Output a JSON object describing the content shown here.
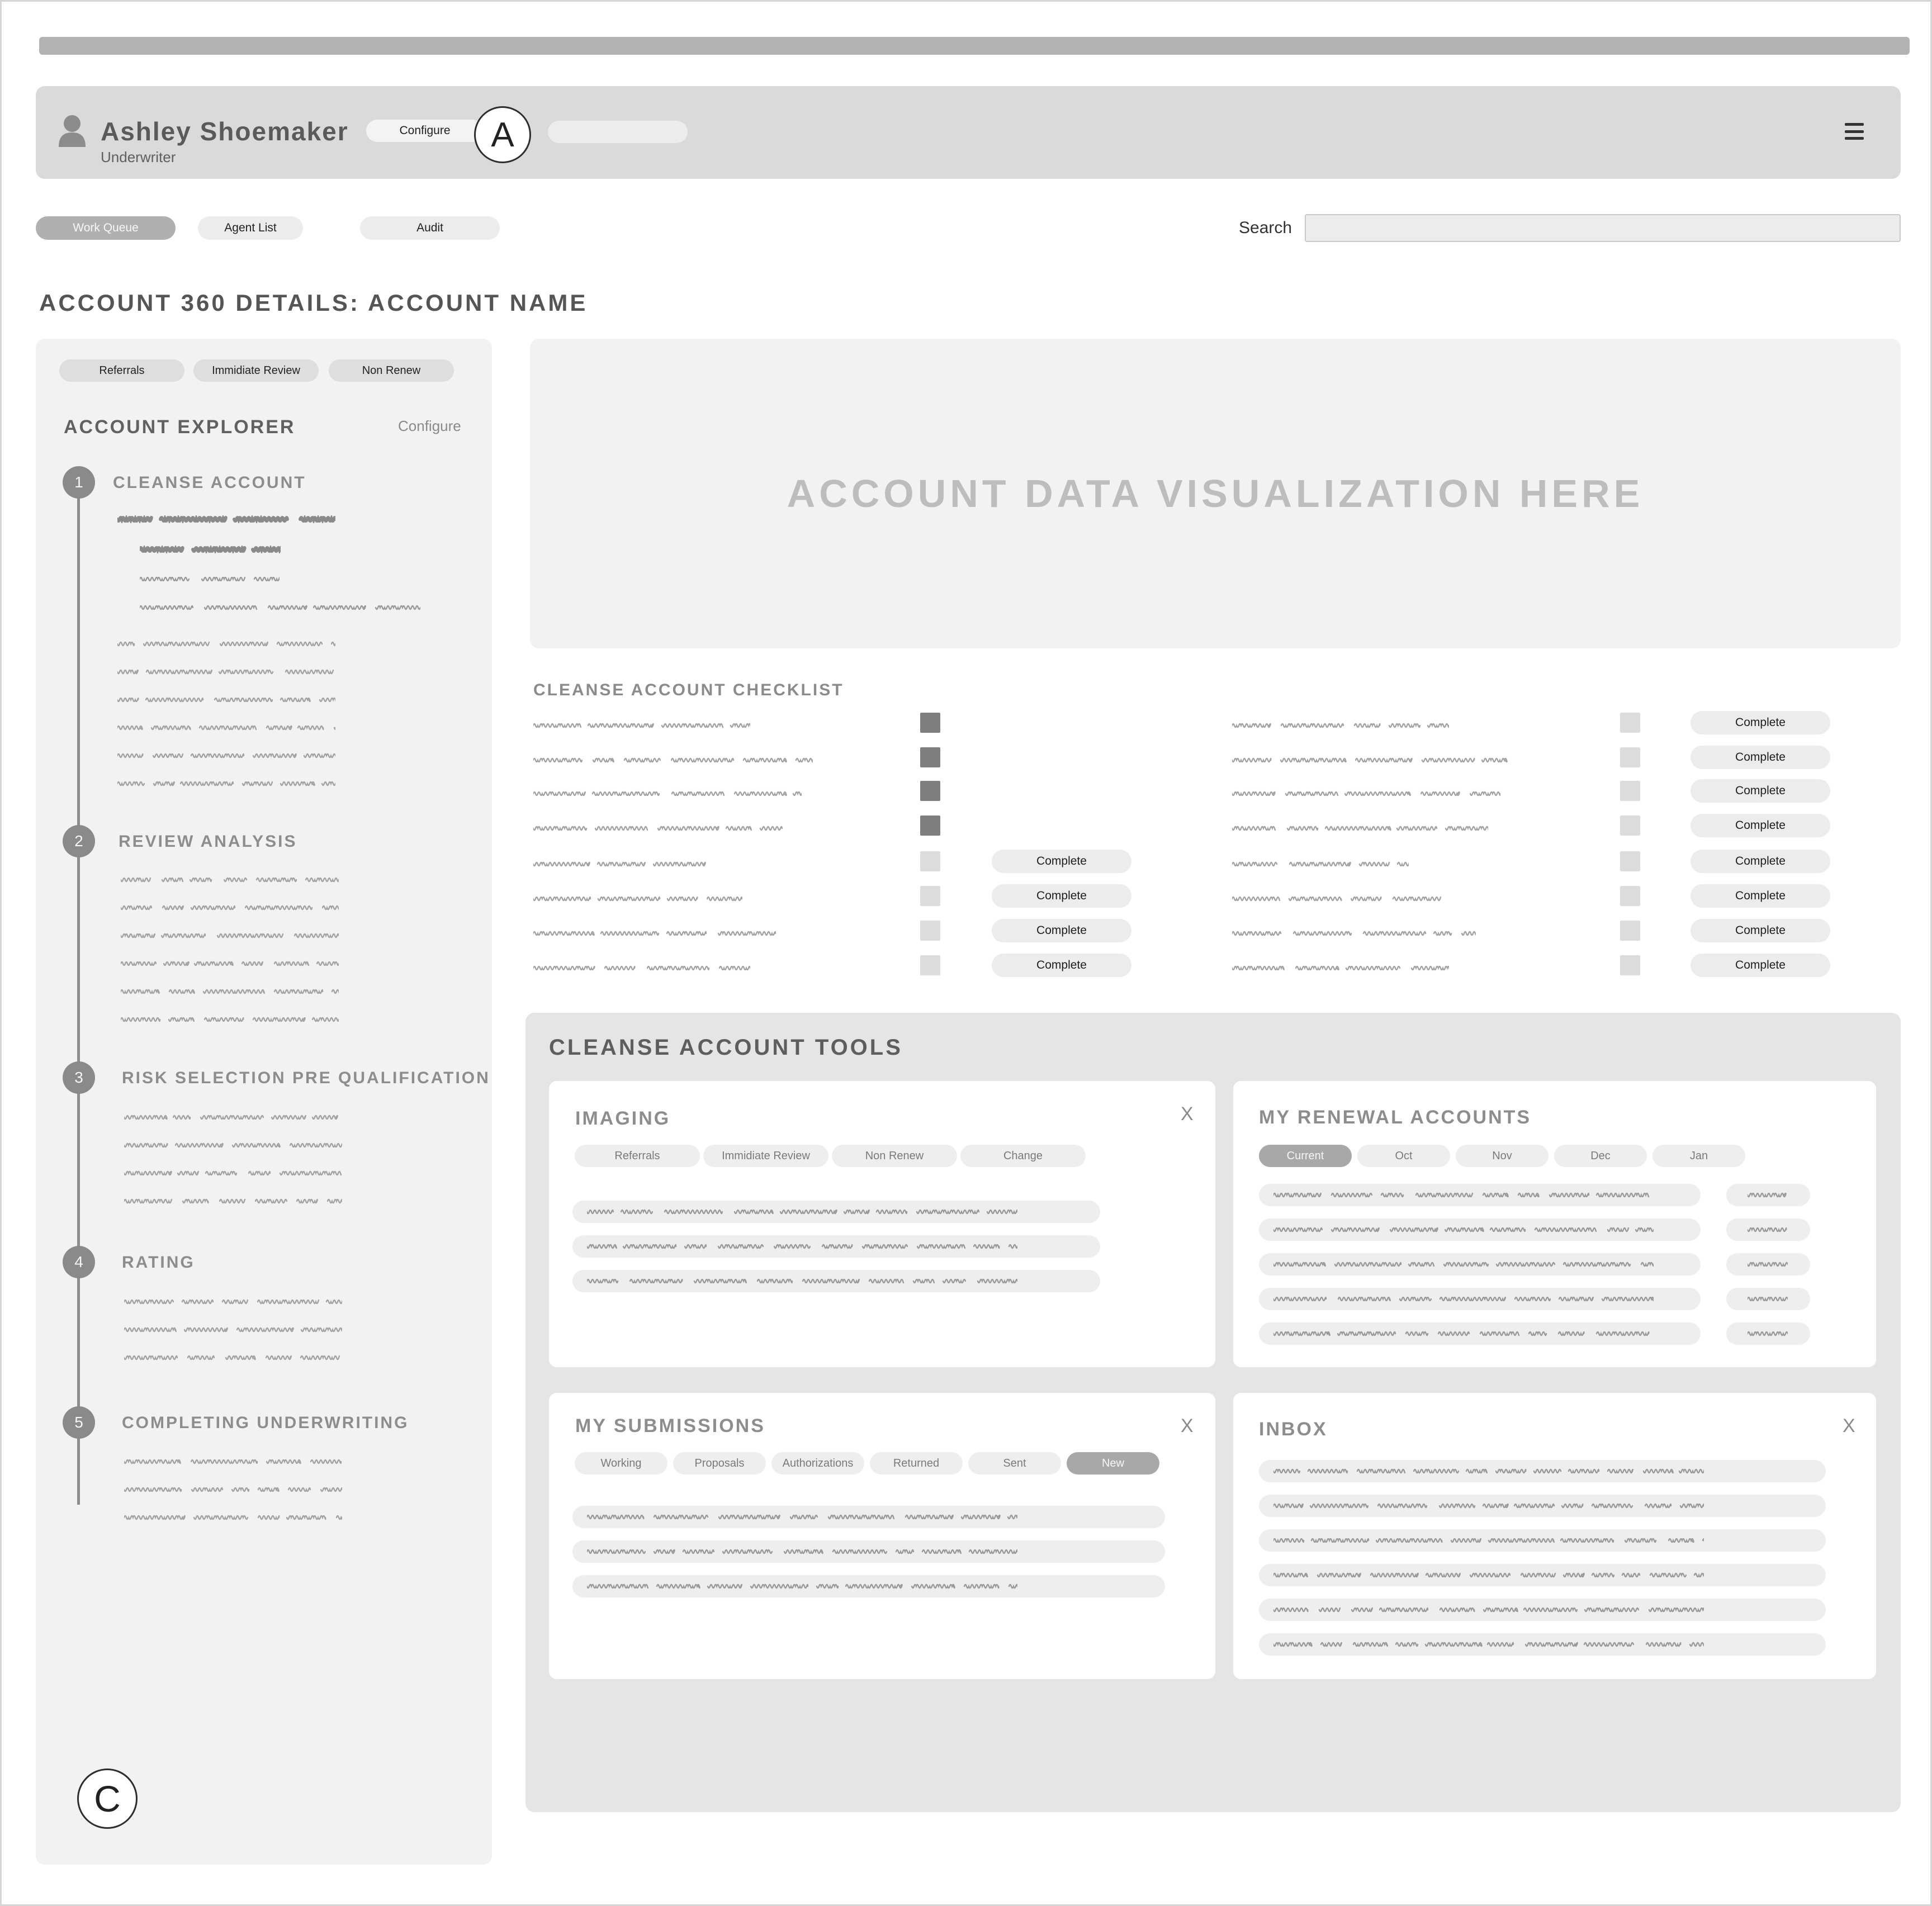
{
  "header": {
    "user_name": "Ashley Shoemaker",
    "user_role": "Underwriter",
    "configure_label": "Configure",
    "annotation_a": "A",
    "menu_icon": "hamburger-icon",
    "avatar_icon": "user-icon"
  },
  "nav": {
    "items": [
      {
        "label": "Work Queue",
        "active": true
      },
      {
        "label": "Agent List",
        "active": false
      },
      {
        "label": "Audit",
        "active": false
      }
    ],
    "search_label": "Search",
    "search_value": ""
  },
  "page": {
    "title": "ACCOUNT 360 DETAILS:  ACCOUNT NAME"
  },
  "sidebar": {
    "filters": [
      "Referrals",
      "Immidiate Review",
      "Non Renew"
    ],
    "explorer_title": "ACCOUNT EXPLORER",
    "configure_label": "Configure",
    "steps": [
      {
        "number": "1",
        "title": "CLEANSE ACCOUNT"
      },
      {
        "number": "2",
        "title": "REVIEW ANALYSIS"
      },
      {
        "number": "3",
        "title": "RISK SELECTION PRE QUALIFICATION"
      },
      {
        "number": "4",
        "title": "RATING"
      },
      {
        "number": "5",
        "title": "COMPLETING UNDERWRITING"
      }
    ],
    "annotation_c": "C"
  },
  "visualization": {
    "placeholder": "ACCOUNT DATA VISUALIZATION HERE"
  },
  "checklist": {
    "title": "CLEANSE ACCOUNT CHECKLIST",
    "complete_label": "Complete",
    "left_checked": [
      true,
      true,
      true,
      true,
      false,
      false,
      false,
      false
    ],
    "left_has_button": [
      false,
      false,
      false,
      false,
      true,
      true,
      true,
      true
    ],
    "right_checked": [
      false,
      false,
      false,
      false,
      false,
      false,
      false,
      false
    ],
    "right_has_button": [
      true,
      true,
      true,
      true,
      true,
      true,
      true,
      true
    ]
  },
  "tools": {
    "title": "CLEANSE ACCOUNT  TOOLS",
    "imaging": {
      "title": "IMAGING",
      "close": "X",
      "tabs": [
        "Referrals",
        "Immidiate Review",
        "Non Renew",
        "Change"
      ]
    },
    "renewals": {
      "title": "MY RENEWAL  ACCOUNTS",
      "tabs": [
        "Current",
        "Oct",
        "Nov",
        "Dec",
        "Jan"
      ],
      "active_tab": "Current"
    },
    "submissions": {
      "title": "MY SUBMISSIONS",
      "close": "X",
      "tabs": [
        "Working",
        "Proposals",
        "Authorizations",
        "Returned",
        "Sent",
        "New"
      ],
      "active_tab": "New"
    },
    "inbox": {
      "title": "INBOX",
      "close": "X"
    }
  }
}
